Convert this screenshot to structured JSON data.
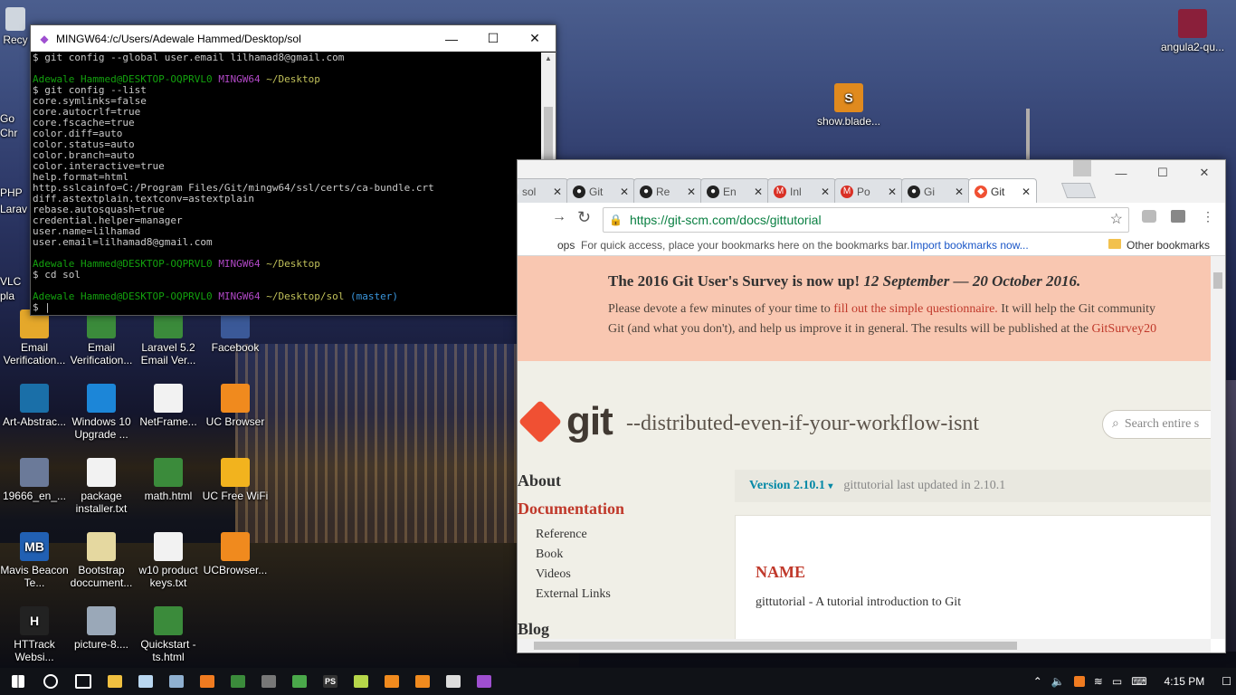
{
  "desktop": {
    "icons_top_left_partial": [
      {
        "label": "Recy",
        "color": "#cfd6de"
      }
    ],
    "icons": [
      {
        "id": "angula2",
        "label": "angula2-qu...",
        "x": "",
        "color": "#8a1f3a"
      },
      {
        "id": "show-blade",
        "label": "show.blade...",
        "color": "#e08a1e",
        "glyph": "S"
      },
      {
        "id": "email-verif-1",
        "label": "Email Verification...",
        "color": "#e5a82b"
      },
      {
        "id": "email-verif-2",
        "label": "Email Verification...",
        "color": "#3b8b3b"
      },
      {
        "id": "laravel-email",
        "label": "Laravel 5.2 Email Ver...",
        "color": "#3b8b3b"
      },
      {
        "id": "facebook",
        "label": "Facebook",
        "color": "#3b5998"
      },
      {
        "id": "art-abstract",
        "label": "Art-Abstrac...",
        "color": "#1a6fa8"
      },
      {
        "id": "windows10",
        "label": "Windows 10 Upgrade ...",
        "color": "#1c86d8"
      },
      {
        "id": "netframe",
        "label": "NetFrame...",
        "color": "#f2f2f2"
      },
      {
        "id": "ucbrowser",
        "label": "UC Browser",
        "color": "#f08a1e"
      },
      {
        "id": "file-19666",
        "label": "19666_en_...",
        "color": "#6b7a99"
      },
      {
        "id": "package-installer",
        "label": "package installer.txt",
        "color": "#f2f2f2"
      },
      {
        "id": "math-html",
        "label": "math.html",
        "color": "#3b8b3b"
      },
      {
        "id": "uc-free-wifi",
        "label": "UC Free WiFi",
        "color": "#f2b31e"
      },
      {
        "id": "mavis-beacon",
        "label": "Mavis Beacon Te...",
        "color": "#2160b3",
        "glyph": "MB"
      },
      {
        "id": "bootstrap-doc",
        "label": "Bootstrap doccument...",
        "color": "#e5d8a0"
      },
      {
        "id": "w10-keys",
        "label": "w10 product keys.txt",
        "color": "#f2f2f2"
      },
      {
        "id": "ucbrowser2",
        "label": "UCBrowser...",
        "color": "#f08a1e"
      },
      {
        "id": "httrack",
        "label": "HTTrack Websi...",
        "color": "#222222",
        "glyph": "H"
      },
      {
        "id": "picture-8",
        "label": "picture-8....",
        "color": "#9aa8b8"
      },
      {
        "id": "quickstart",
        "label": "Quickstart - ts.html",
        "color": "#3b8b3b"
      }
    ],
    "partial_left": [
      "Go",
      "Chr",
      "PHP",
      "Larav",
      "VLC",
      "pla"
    ]
  },
  "terminal": {
    "title": "MINGW64:/c/Users/Adewale Hammed/Desktop/sol",
    "lines": [
      {
        "parts": [
          {
            "t": "$ git config --global user.email lilhamad8@gmail.com",
            "c": ""
          }
        ]
      },
      {
        "parts": [
          {
            "t": "",
            "c": ""
          }
        ]
      },
      {
        "parts": [
          {
            "t": "Adewale Hammed@DESKTOP-OQPRVL0 ",
            "c": "g"
          },
          {
            "t": "MINGW64 ",
            "c": "m"
          },
          {
            "t": "~/Desktop",
            "c": "y"
          }
        ]
      },
      {
        "parts": [
          {
            "t": "$ git config --list",
            "c": ""
          }
        ]
      },
      {
        "parts": [
          {
            "t": "core.symlinks=false",
            "c": ""
          }
        ]
      },
      {
        "parts": [
          {
            "t": "core.autocrlf=true",
            "c": ""
          }
        ]
      },
      {
        "parts": [
          {
            "t": "core.fscache=true",
            "c": ""
          }
        ]
      },
      {
        "parts": [
          {
            "t": "color.diff=auto",
            "c": ""
          }
        ]
      },
      {
        "parts": [
          {
            "t": "color.status=auto",
            "c": ""
          }
        ]
      },
      {
        "parts": [
          {
            "t": "color.branch=auto",
            "c": ""
          }
        ]
      },
      {
        "parts": [
          {
            "t": "color.interactive=true",
            "c": ""
          }
        ]
      },
      {
        "parts": [
          {
            "t": "help.format=html",
            "c": ""
          }
        ]
      },
      {
        "parts": [
          {
            "t": "http.sslcainfo=C:/Program Files/Git/mingw64/ssl/certs/ca-bundle.crt",
            "c": ""
          }
        ]
      },
      {
        "parts": [
          {
            "t": "diff.astextplain.textconv=astextplain",
            "c": ""
          }
        ]
      },
      {
        "parts": [
          {
            "t": "rebase.autosquash=true",
            "c": ""
          }
        ]
      },
      {
        "parts": [
          {
            "t": "credential.helper=manager",
            "c": ""
          }
        ]
      },
      {
        "parts": [
          {
            "t": "user.name=lilhamad",
            "c": ""
          }
        ]
      },
      {
        "parts": [
          {
            "t": "user.email=lilhamad8@gmail.com",
            "c": ""
          }
        ]
      },
      {
        "parts": [
          {
            "t": "",
            "c": ""
          }
        ]
      },
      {
        "parts": [
          {
            "t": "Adewale Hammed@DESKTOP-OQPRVL0 ",
            "c": "g"
          },
          {
            "t": "MINGW64 ",
            "c": "m"
          },
          {
            "t": "~/Desktop",
            "c": "y"
          }
        ]
      },
      {
        "parts": [
          {
            "t": "$ cd sol",
            "c": ""
          }
        ]
      },
      {
        "parts": [
          {
            "t": "",
            "c": ""
          }
        ]
      },
      {
        "parts": [
          {
            "t": "Adewale Hammed@DESKTOP-OQPRVL0 ",
            "c": "g"
          },
          {
            "t": "MINGW64 ",
            "c": "m"
          },
          {
            "t": "~/Desktop/sol ",
            "c": "y"
          },
          {
            "t": "(master)",
            "c": "c"
          }
        ]
      },
      {
        "parts": [
          {
            "t": "$ |",
            "c": ""
          }
        ]
      }
    ]
  },
  "chrome": {
    "tabs": [
      {
        "label": "sol",
        "fav_color": "#f2f2f2",
        "fav_glyph": ""
      },
      {
        "label": "Git",
        "fav_color": "#222222",
        "fav_glyph": "●"
      },
      {
        "label": "Re",
        "fav_color": "#222222",
        "fav_glyph": "●"
      },
      {
        "label": "En",
        "fav_color": "#222222",
        "fav_glyph": "●"
      },
      {
        "label": "Inl",
        "fav_color": "#d93025",
        "fav_glyph": "M"
      },
      {
        "label": "Po",
        "fav_color": "#d93025",
        "fav_glyph": "M"
      },
      {
        "label": "Gi",
        "fav_color": "#222222",
        "fav_glyph": "●"
      },
      {
        "label": "Git",
        "fav_color": "#f05033",
        "fav_glyph": "◆",
        "active": true
      }
    ],
    "url": "https://git-scm.com/docs/gittutorial",
    "bookmarks_left": "ops",
    "bookmarks_hint": "For quick access, place your bookmarks here on the bookmarks bar.",
    "bookmarks_import": "Import bookmarks now...",
    "other_bookmarks": "Other bookmarks",
    "page": {
      "survey_title": "The 2016 Git User's Survey is now up!",
      "survey_dates": "12 September — 20 October 2016.",
      "survey_line1_a": "Please devote a few minutes of your time to",
      "survey_line1_link": "fill out the simple questionnaire.",
      "survey_line1_b": "It will help the Git community",
      "survey_line2_a": "Git (and what you don't), and help us improve it in general. The results will be published at the",
      "survey_line2_link": "GitSurvey20",
      "logo_word": "git",
      "tagline": "--distributed-even-if-your-workflow-isnt",
      "search_placeholder": "Search entire s",
      "nav": {
        "about": "About",
        "documentation": "Documentation",
        "items": [
          "Reference",
          "Book",
          "Videos",
          "External Links"
        ],
        "blog": "Blog"
      },
      "version": "Version 2.10.1",
      "version_arrow": "▾",
      "updated": "gittutorial last updated in 2.10.1",
      "section_name": "NAME",
      "section_desc": "gittutorial - A tutorial introduction to Git"
    }
  },
  "taskbar": {
    "time": "4:15 PM",
    "items": [
      {
        "name": "start-button",
        "color": "#ffffff"
      },
      {
        "name": "search-button",
        "color": "#ffffff"
      },
      {
        "name": "task-view-button",
        "color": "#ffffff"
      },
      {
        "name": "file-explorer",
        "color": "#f0c040"
      },
      {
        "name": "notepad",
        "color": "#b9d7f0"
      },
      {
        "name": "remote",
        "color": "#8fb0d0"
      },
      {
        "name": "xampp",
        "color": "#f07b20"
      },
      {
        "name": "chrome",
        "color": "#3b8b3b"
      },
      {
        "name": "calculator",
        "color": "#777777"
      },
      {
        "name": "photos",
        "color": "#4aa84a"
      },
      {
        "name": "phpstorm",
        "color": "#333333",
        "glyph": "PS"
      },
      {
        "name": "sticky",
        "color": "#b6d64a"
      },
      {
        "name": "ucbrowser",
        "color": "#f08a1e"
      },
      {
        "name": "vlc",
        "color": "#f08a1e"
      },
      {
        "name": "mail",
        "color": "#dddddd"
      },
      {
        "name": "git-bash",
        "color": "#9f4fd0"
      }
    ]
  }
}
